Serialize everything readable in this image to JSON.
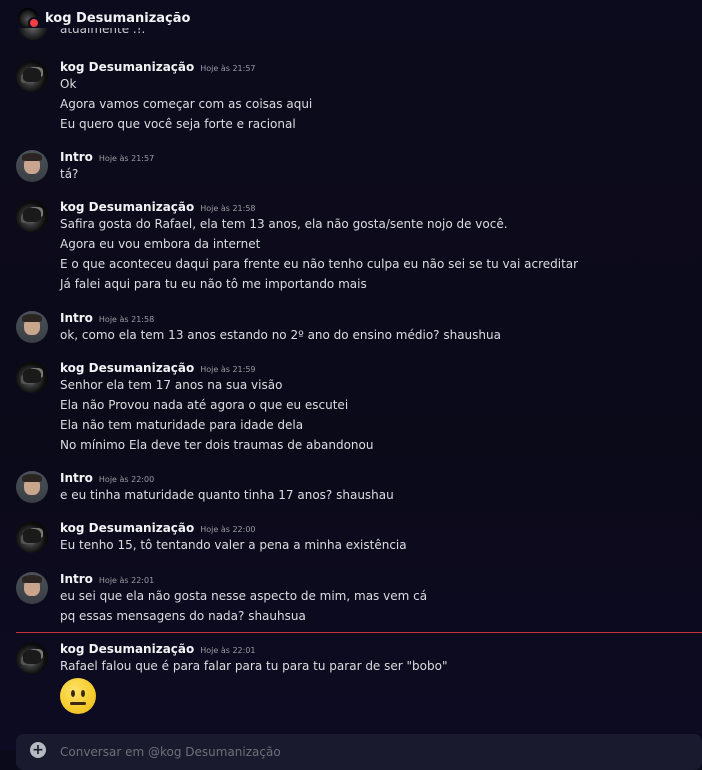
{
  "channel": {
    "title": "kog Desumanização"
  },
  "cutoff_text": "atualmente .!.",
  "messages": [
    {
      "author": "kog Desumanização",
      "avatar": "kog-avatar",
      "timestamp": "Hoje às 21:57",
      "lines": [
        "Ok",
        "Agora vamos começar com as coisas aqui",
        "Eu quero que você seja forte e racional"
      ]
    },
    {
      "author": "Intro",
      "avatar": "intro-avatar",
      "timestamp": "Hoje às 21:57",
      "lines": [
        "tá?"
      ]
    },
    {
      "author": "kog Desumanização",
      "avatar": "kog-avatar",
      "timestamp": "Hoje às 21:58",
      "lines": [
        "Safira gosta do Rafael, ela tem 13 anos, ela não gosta/sente nojo de você.",
        "Agora eu vou embora da internet",
        "E o que aconteceu daqui para frente eu não tenho culpa eu não sei se tu vai acreditar",
        "Já falei aqui para tu eu não tô me importando mais"
      ]
    },
    {
      "author": "Intro",
      "avatar": "intro-avatar",
      "timestamp": "Hoje às 21:58",
      "lines": [
        "ok, como ela tem 13 anos estando no 2º ano do ensino médio? shaushua"
      ]
    },
    {
      "author": "kog Desumanização",
      "avatar": "kog-avatar",
      "timestamp": "Hoje às 21:59",
      "lines": [
        "Senhor ela tem 17 anos na sua visão",
        "Ela não Provou nada até agora o que eu escutei",
        "Ela não tem maturidade para idade dela",
        "No mínimo Ela deve ter dois traumas de abandonou"
      ]
    },
    {
      "author": "Intro",
      "avatar": "intro-avatar",
      "timestamp": "Hoje às 22:00",
      "lines": [
        "e eu tinha maturidade quanto tinha 17 anos? shaushau"
      ]
    },
    {
      "author": "kog Desumanização",
      "avatar": "kog-avatar",
      "timestamp": "Hoje às 22:00",
      "lines": [
        "Eu tenho 15, tô tentando valer a pena a minha existência"
      ]
    },
    {
      "author": "Intro",
      "avatar": "intro-avatar",
      "timestamp": "Hoje às 22:01",
      "lines": [
        "eu sei que ela não gosta nesse aspecto de mim, mas vem cá",
        "pq essas mensagens do nada? shauhsua"
      ]
    },
    {
      "author": "kog Desumanização",
      "avatar": "kog-avatar",
      "timestamp": "Hoje às 22:01",
      "lines": [
        "Rafael falou que é para falar para tu para tu parar de ser \"bobo\""
      ],
      "emoji": "neutral-face-emoji"
    }
  ],
  "composer": {
    "placeholder": "Conversar em @kog Desumanização"
  },
  "colors": {
    "background": "#0b0a1a",
    "new_messages_divider": "#c8313a",
    "status_dnd": "#f23f43"
  }
}
